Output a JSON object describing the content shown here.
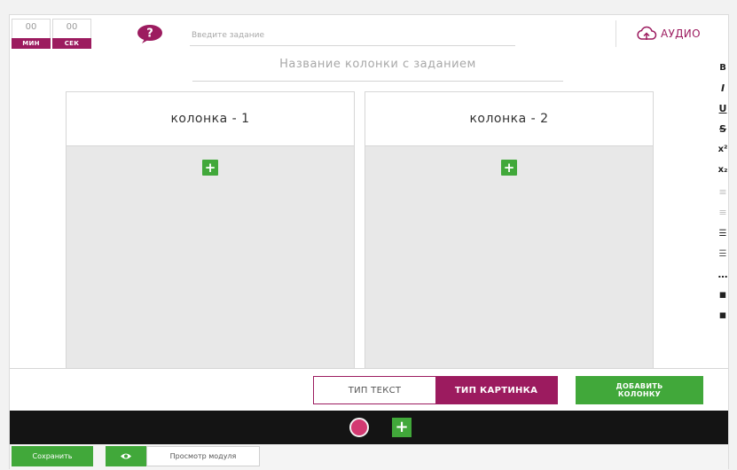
{
  "timer": {
    "minutes_value": "00",
    "minutes_label": "МИН",
    "seconds_value": "00",
    "seconds_label": "СЕК"
  },
  "task_input": {
    "placeholder": "Введите задание",
    "value": ""
  },
  "audio": {
    "label": "АУДИО",
    "icon": "cloud-upload-icon"
  },
  "column_title_placeholder": "Название колонки с заданием",
  "columns": [
    {
      "title": "колонка - 1",
      "add_label": "+"
    },
    {
      "title": "колонка - 2",
      "add_label": "+"
    }
  ],
  "toolbar": [
    {
      "name": "bold",
      "glyph": "B"
    },
    {
      "name": "italic",
      "glyph": "I"
    },
    {
      "name": "underline",
      "glyph": "U"
    },
    {
      "name": "strikethrough",
      "glyph": "S"
    },
    {
      "name": "superscript",
      "glyph": "x²"
    },
    {
      "name": "subscript",
      "glyph": "x₂"
    },
    {
      "name": "align-left",
      "glyph": "≡"
    },
    {
      "name": "align-center",
      "glyph": "≡"
    },
    {
      "name": "unordered-list",
      "glyph": "☰"
    },
    {
      "name": "ordered-list",
      "glyph": "☰"
    },
    {
      "name": "more",
      "glyph": "…"
    },
    {
      "name": "comment",
      "glyph": "▪"
    },
    {
      "name": "media",
      "glyph": "▪"
    }
  ],
  "type_toggle": {
    "text_label": "ТИП ТЕКСТ",
    "image_label": "ТИП КАРТИНКА",
    "selected": "image"
  },
  "add_column": {
    "line1": "ДОБАВИТЬ",
    "line2": "КОЛОНКУ"
  },
  "strip": {
    "add_label": "+"
  },
  "footer": {
    "save_label": "Сохранить",
    "preview_label": "Просмотр модуля"
  },
  "colors": {
    "accent": "#9c1b5f",
    "green": "#41a83a",
    "dark": "#141414",
    "record": "#d33a72"
  }
}
